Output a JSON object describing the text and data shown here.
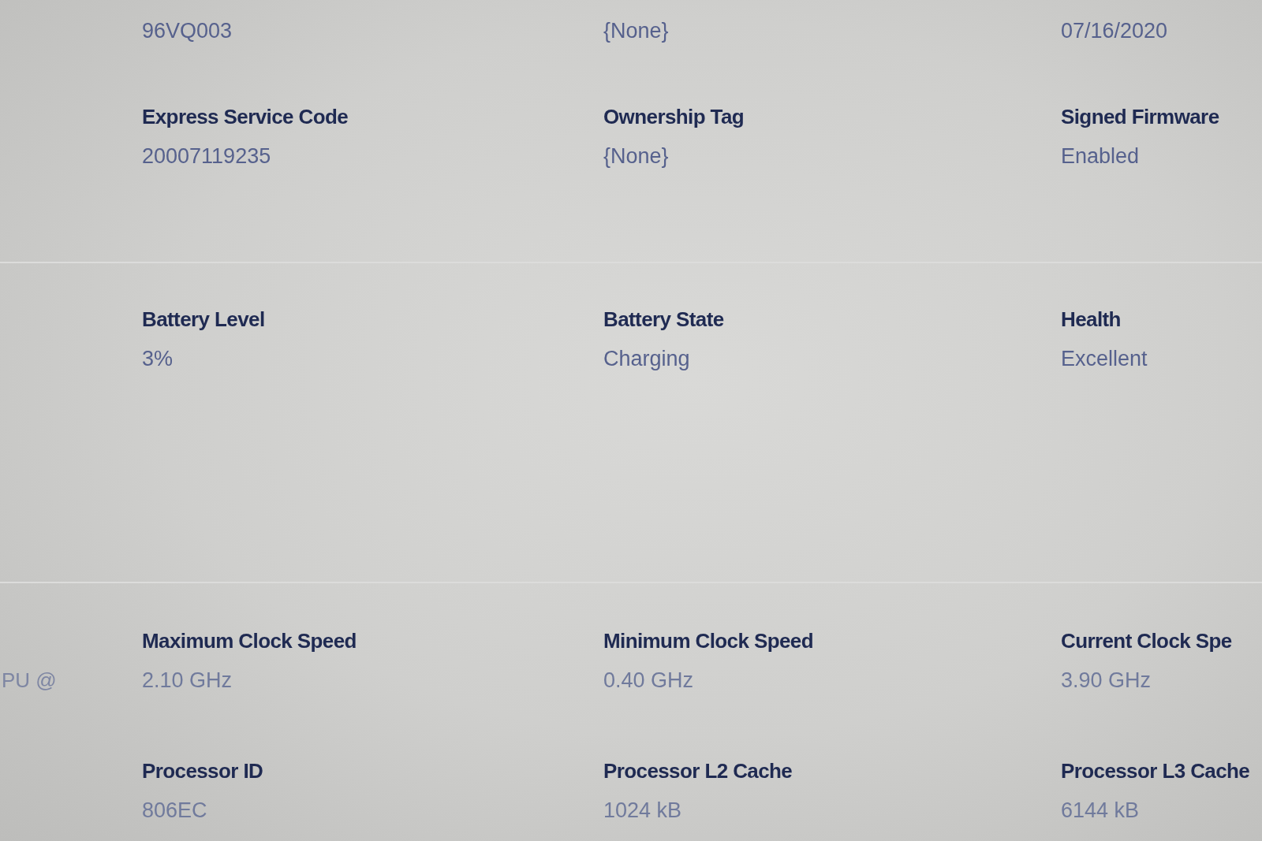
{
  "sections": [
    {
      "rows": [
        [
          {
            "value": "96VQ003"
          },
          {
            "value": "{None}"
          },
          {
            "value": "07/16/2020"
          }
        ],
        [
          {
            "label": "Express Service Code",
            "value": "20007119235"
          },
          {
            "label": "Ownership Tag",
            "value": "{None}"
          },
          {
            "label": "Signed Firmware",
            "value": "Enabled"
          }
        ]
      ]
    },
    {
      "rows": [
        [
          {
            "label": "Battery Level",
            "value": "3%"
          },
          {
            "label": "Battery State",
            "value": "Charging"
          },
          {
            "label": "Health",
            "value": "Excellent"
          }
        ]
      ]
    },
    {
      "side_text": "PU @",
      "rows": [
        [
          {
            "label": "Maximum Clock Speed",
            "value": "2.10 GHz"
          },
          {
            "label": "Minimum Clock Speed",
            "value": "0.40 GHz"
          },
          {
            "label": "Current Clock Spe",
            "value": "3.90 GHz"
          }
        ],
        [
          {
            "label": "Processor ID",
            "value": "806EC"
          },
          {
            "label": "Processor L2 Cache",
            "value": "1024 kB"
          },
          {
            "label": "Processor L3 Cache",
            "value": "6144 kB"
          }
        ]
      ]
    }
  ]
}
